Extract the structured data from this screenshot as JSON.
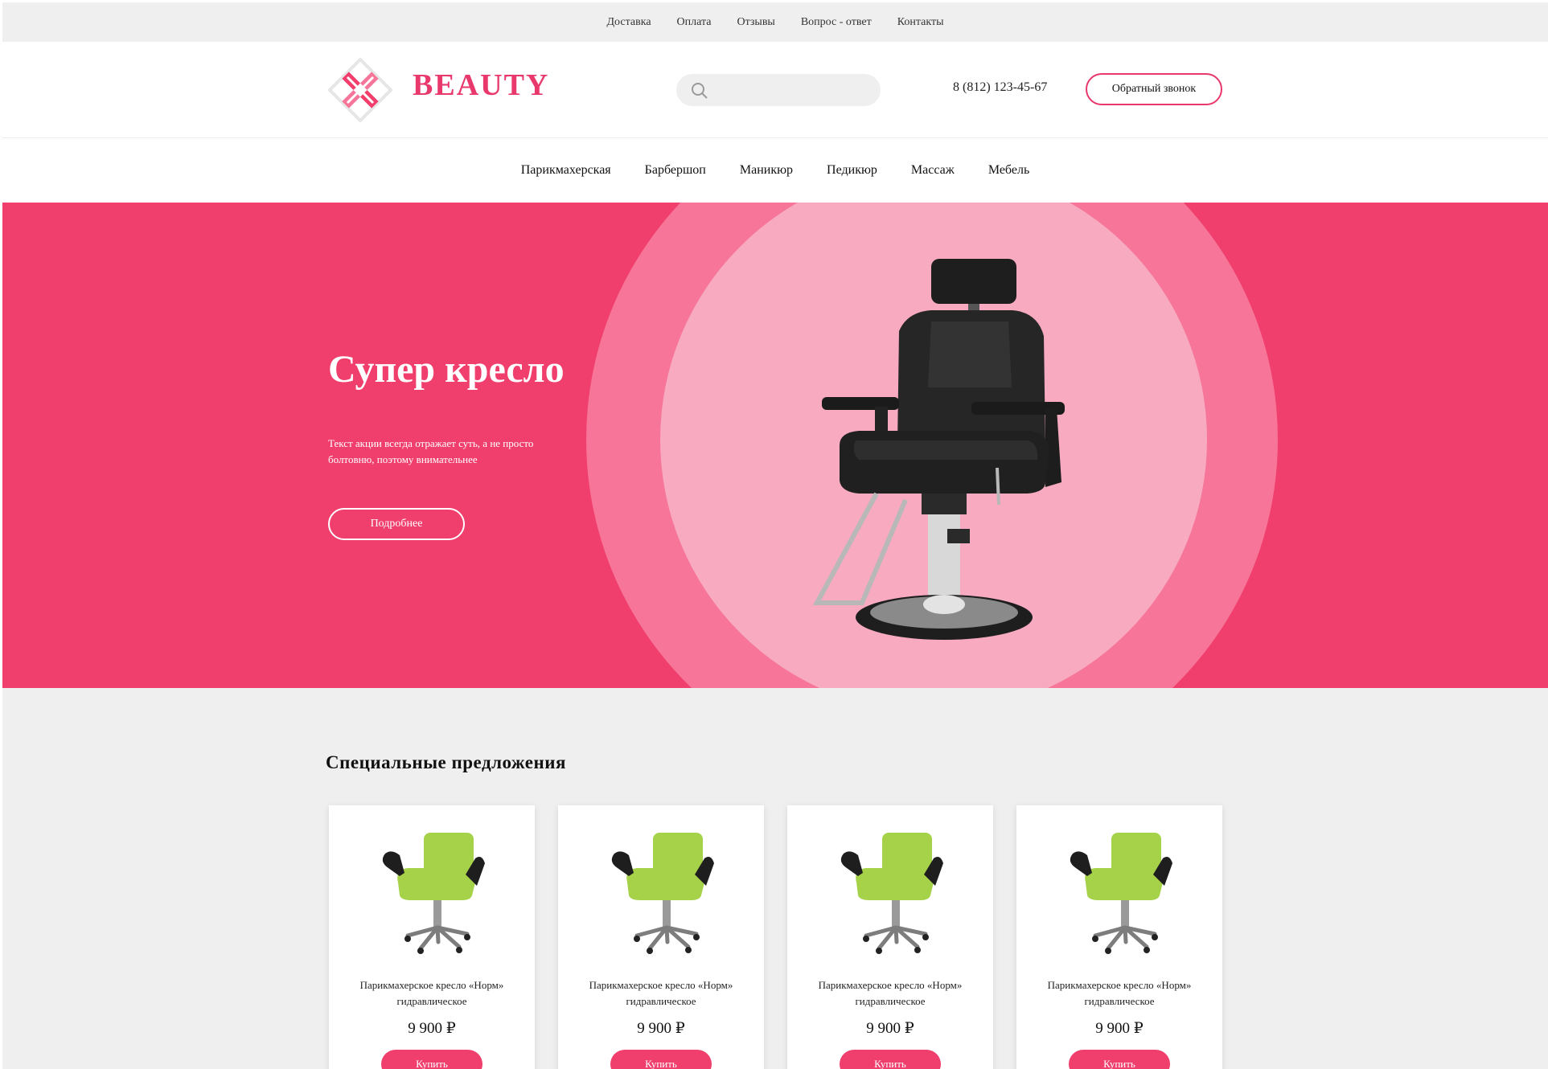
{
  "topnav": {
    "items": [
      "Доставка",
      "Оплата",
      "Отзывы",
      "Вопрос - ответ",
      "Контакты"
    ]
  },
  "header": {
    "logo_text": "BEAUTY",
    "search_placeholder": "",
    "phone": "8 (812) 123-45-67",
    "callback_label": "Обратный звонок"
  },
  "mainnav": {
    "items": [
      "Парикмахерская",
      "Барбершоп",
      "Маникюр",
      "Педикюр",
      "Массаж",
      "Мебель"
    ]
  },
  "hero": {
    "title": "Супер кресло",
    "text": "Текст акции всегда отражает суть, а не просто болтовню, поэтому внимательнее",
    "button_label": "Подробнее"
  },
  "offers": {
    "title": "Специальные предложения",
    "cards": [
      {
        "name": "Парикмахерское кресло «Норм» гидравлическое",
        "price": "9 900 ₽",
        "button": "Купить"
      },
      {
        "name": "Парикмахерское кресло «Норм» гидравлическое",
        "price": "9 900 ₽",
        "button": "Купить"
      },
      {
        "name": "Парикмахерское кресло «Норм» гидравлическое",
        "price": "9 900 ₽",
        "button": "Купить"
      },
      {
        "name": "Парикмахерское кресло «Норм» гидравлическое",
        "price": "9 900 ₽",
        "button": "Купить"
      }
    ]
  },
  "colors": {
    "accent": "#f03e6d",
    "circle_outer": "#f67599",
    "circle_inner": "#f7aac0",
    "chair_green": "#a6d24a",
    "background_gray": "#efefef"
  },
  "icons": {
    "logo": "logo-diamond-icon",
    "search": "search-icon"
  }
}
